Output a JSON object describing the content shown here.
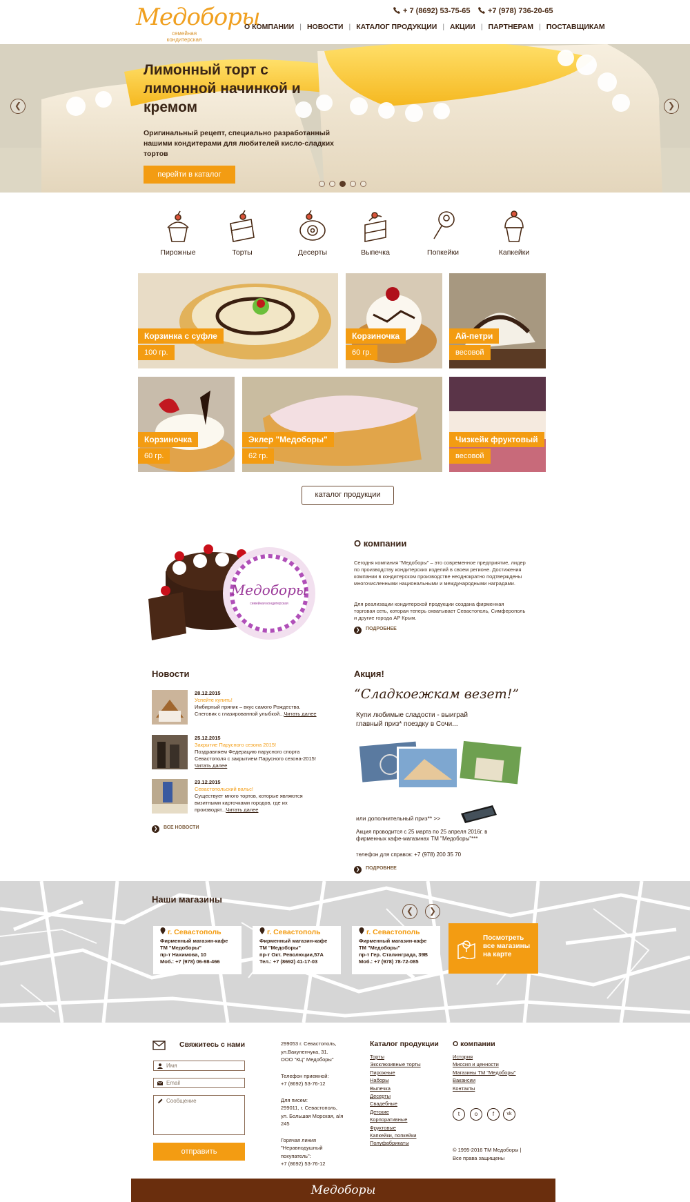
{
  "header": {
    "logo_main": "Медоборы",
    "logo_sub": "семейная кондитерская",
    "phone1": "+ 7 (8692) 53-75-65",
    "phone2": "+7 (978) 736-20-65",
    "nav": [
      "О КОМПАНИИ",
      "НОВОСТИ",
      "КАТАЛОГ ПРОДУКЦИИ",
      "АКЦИИ",
      "ПАРТНЕРАМ",
      "ПОСТАВЩИКАМ"
    ]
  },
  "hero": {
    "title": "Лимонный торт с лимонной начинкой и кремом",
    "text": "Оригинальный рецепт, специально разработанный нашими кондитерами для любителей кисло-сладких тортов",
    "button": "перейти в каталог",
    "slides_total": 5,
    "active_slide": 3
  },
  "categories": [
    "Пирожные",
    "Торты",
    "Десерты",
    "Выпечка",
    "Попкейки",
    "Капкейки"
  ],
  "products": [
    {
      "name": "Корзинка с суфле",
      "weight": "100 гр."
    },
    {
      "name": "Корзиночка",
      "weight": "60 гр."
    },
    {
      "name": "Ай-петри",
      "weight": "весовой"
    },
    {
      "name": "Корзиночка",
      "weight": "60 гр."
    },
    {
      "name": "Эклер \"Медоборы\"",
      "weight": "62 гр."
    },
    {
      "name": "Чизкейк фруктовый",
      "weight": "весовой"
    }
  ],
  "catalog_button": "каталог продукции",
  "about": {
    "title": "О компании",
    "p1": "Сегодня компания \"Медоборы\" – это современное предприятие, лидер по производству кондитерских изделий в своем регионе. Достижения компании в кондитерском производстве неоднократно подтверждены многочисленными национальными и международными наградами.",
    "p2": "Для реализации кондитерской продукции создана фирменная торговая сеть, которая теперь охватывает Севастополь, Симферополь и другие города АР Крым.",
    "more": "ПОДРОБНЕЕ",
    "badge_text": "Медоборы",
    "badge_sub": "семейная кондитерская"
  },
  "news": {
    "title": "Новости",
    "items": [
      {
        "date": "28.12.2015",
        "title": "Успейте купить!",
        "text": "Имбирный пряник – вкус самого Рождества. Сneговик с глазированной улыбкой...",
        "link": "Читать далее"
      },
      {
        "date": "25.12.2015",
        "title": "Закрытие Парусного сезона 2015!",
        "text": "Поздравляем Федерацию парусного спорта Севастополя с закрытием Парусного сезона-2015!",
        "link": "Читать далее"
      },
      {
        "date": "23.12.2015",
        "title": "Севастопольский вальс!",
        "text": "Существует много тортов, которые являются визитными карточками городов, где их производят...",
        "link": "Читать далее"
      }
    ],
    "all": "ВСЕ НОВОСТИ"
  },
  "promo": {
    "title": "Акция!",
    "slogan": "“Сладкоежкам везет!”",
    "line1": "Купи любимые сладости - выиграй",
    "line2": "главный приз* поездку  в Сочи...",
    "extra": "или дополнительный приз** >>",
    "dates1": "Акция проводится с 25 марта по 25 апреля 2016г. в",
    "dates2": "фирменных кафе-магазинах ТМ \"Медоборы\"***",
    "phone": "телефон для справок: +7 (978) 200 35 70",
    "more": "ПОДРОБНЕЕ"
  },
  "stores": {
    "title": "Наши магазины",
    "items": [
      {
        "city": "г. Севастополь",
        "type": "Фирменный магазин-кафе",
        "brand": "ТМ \"Медоборы\"",
        "address": "пр-т Нахимова, 10",
        "phone": "Моб.: +7 (978) 06-98-466"
      },
      {
        "city": "г. Севастополь",
        "type": "Фирменный магазин-кафе",
        "brand": "ТМ \"Медоборы\"",
        "address": "пр-т Окт. Революции,57А",
        "phone": "Тел.: +7 (8692) 41-17-03"
      },
      {
        "city": "г. Севастополь",
        "type": "Фирменный магазин-кафе",
        "brand": "ТМ \"Медоборы\"",
        "address": "пр-т Гер. Сталинграда, 39В",
        "phone": "Моб.: +7 (978) 78-72-085"
      }
    ],
    "map_button_l1": "Посмотреть",
    "map_button_l2": "все магазины",
    "map_button_l3": "на карте"
  },
  "footer": {
    "contact_title": "Свяжитесь с нами",
    "name_ph": "Имя",
    "email_ph": "Email",
    "msg_ph": "Сообщение",
    "send": "отправить",
    "addr": [
      "299053 г. Севастополь,",
      "ул.Вакуленчука, 31.",
      "ООО \"КЦ\" Медоборы\""
    ],
    "reception": [
      "Телефон приемной:",
      "+7 (8692) 53-76-12"
    ],
    "mail": [
      "Для писем:",
      "299011, г. Севастополь,",
      "ул. Большая Морская, а/я",
      "245"
    ],
    "hotline": [
      "Горячая линия",
      "\"Неравнодушный",
      "покупатель\":",
      "+7 (8692) 53-76-12"
    ],
    "catalog_title": "Каталог продукции",
    "catalog": [
      "Торты",
      "Эксклюзивные торты",
      "Пирожные",
      "Наборы",
      "Выпечка",
      "Десерты",
      "Свадебные",
      "Детские",
      "Корпоративные",
      "Фруктовые",
      "Капкейки, попкейки",
      "Полуфабрикаты"
    ],
    "company_title": "О компании",
    "company": [
      "История",
      "Миссия и ценности",
      "Магазины ТМ \"Медоборы\"",
      "Вакансии",
      "Контакты"
    ],
    "social": [
      "twitter-icon",
      "odnoklassniki-icon",
      "facebook-icon",
      "vk-icon"
    ],
    "copy1": "© 1995-2016 ТМ Медоборы |",
    "copy2": "Все права защищены",
    "bottom_logo": "Медоборы"
  },
  "colors": {
    "accent": "#f39c12",
    "brown": "#3a2214",
    "footer_bar": "#6a2e0d"
  }
}
